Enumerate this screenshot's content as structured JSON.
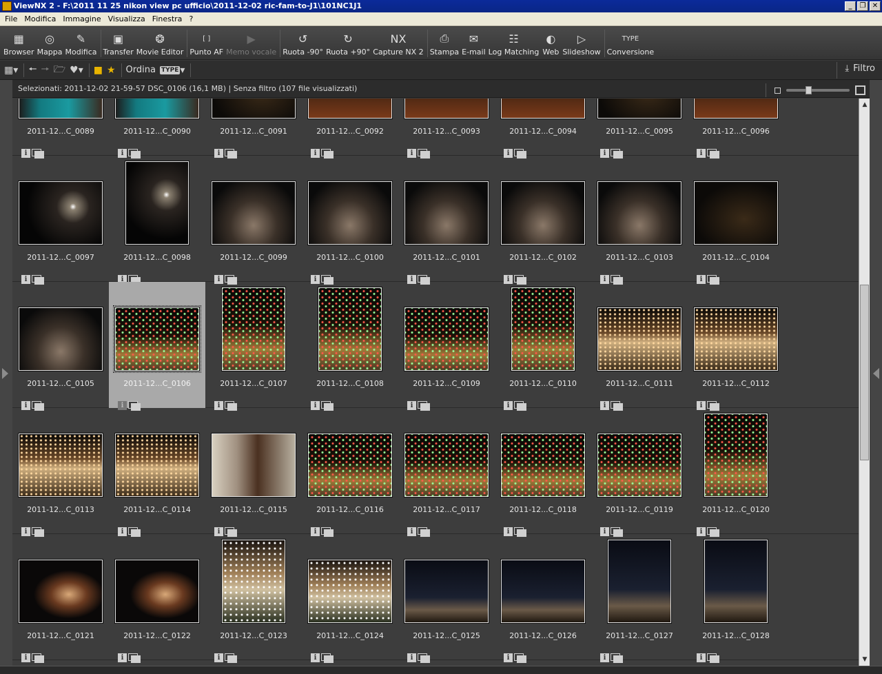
{
  "window": {
    "title": "ViewNX 2 - F:\\2011 11 25 nikon view pc ufficio\\2011-12-02 ric-fam-to-J1\\101NC1J1",
    "controls": [
      "_",
      "❐",
      "✕"
    ]
  },
  "menu": [
    "File",
    "Modifica",
    "Immagine",
    "Visualizza",
    "Finestra",
    "?"
  ],
  "toolbar": [
    {
      "label": "Browser",
      "icon": "browser-icon",
      "glyph": "▦",
      "enabled": true
    },
    {
      "label": "Mappa",
      "icon": "map-icon",
      "glyph": "◎",
      "enabled": true
    },
    {
      "label": "Modifica",
      "icon": "edit-icon",
      "glyph": "✎",
      "enabled": true
    },
    {
      "sep": true
    },
    {
      "label": "Transfer",
      "icon": "camera-transfer-icon",
      "glyph": "▣",
      "enabled": true
    },
    {
      "label": "Movie Editor",
      "icon": "film-reel-icon",
      "glyph": "❂",
      "enabled": true
    },
    {
      "sep": true
    },
    {
      "label": "Punto AF",
      "icon": "af-point-icon",
      "glyph": "[ ]",
      "enabled": true
    },
    {
      "label": "Memo vocale",
      "icon": "voice-memo-icon",
      "glyph": "▶",
      "enabled": false
    },
    {
      "sep": true
    },
    {
      "label": "Ruota -90°",
      "icon": "rotate-left-icon",
      "glyph": "↺",
      "enabled": true
    },
    {
      "label": "Ruota +90°",
      "icon": "rotate-right-icon",
      "glyph": "↻",
      "enabled": true
    },
    {
      "label": "Capture NX 2",
      "icon": "capture-nx-icon",
      "glyph": "NX",
      "enabled": true
    },
    {
      "sep": true
    },
    {
      "label": "Stampa",
      "icon": "printer-icon",
      "glyph": "⎙",
      "enabled": true
    },
    {
      "label": "E-mail",
      "icon": "envelope-icon",
      "glyph": "✉",
      "enabled": true
    },
    {
      "label": "Log Matching",
      "icon": "log-matching-icon",
      "glyph": "☷",
      "enabled": true
    },
    {
      "label": "Web",
      "icon": "globe-icon",
      "glyph": "◐",
      "enabled": true
    },
    {
      "label": "Slideshow",
      "icon": "slideshow-icon",
      "glyph": "▷",
      "enabled": true
    },
    {
      "sep": true
    },
    {
      "label": "Conversione",
      "icon": "convert-type-icon",
      "glyph": "TYPE",
      "enabled": true
    }
  ],
  "toolbar2": {
    "sort_label": "Ordina",
    "type_badge": "TYPE",
    "filter_label": "Filtro"
  },
  "status": {
    "text": "Selezionati: 2011-12-02 21-59-57 DSC_0106 (16,1 MB) | Senza filtro  (107 file visualizzati)"
  },
  "thumbnails": {
    "selected": "2011-12...C_0106",
    "rows": [
      [
        {
          "label": "2011-12...C_0089",
          "style": "p-teal",
          "orient": "landscape"
        },
        {
          "label": "2011-12...C_0090",
          "style": "p-teal",
          "orient": "landscape"
        },
        {
          "label": "2011-12...C_0091",
          "style": "p-night",
          "orient": "landscape"
        },
        {
          "label": "2011-12...C_0092",
          "style": "p-street",
          "orient": "landscape"
        },
        {
          "label": "2011-12...C_0093",
          "style": "p-street",
          "orient": "landscape"
        },
        {
          "label": "2011-12...C_0094",
          "style": "p-street",
          "orient": "landscape"
        },
        {
          "label": "2011-12...C_0095",
          "style": "p-night",
          "orient": "landscape"
        },
        {
          "label": "2011-12...C_0096",
          "style": "p-street",
          "orient": "landscape"
        }
      ],
      [
        {
          "label": "2011-12...C_0097",
          "style": "p-church",
          "orient": "landscape"
        },
        {
          "label": "2011-12...C_0098",
          "style": "p-church",
          "orient": "portrait"
        },
        {
          "label": "2011-12...C_0099",
          "style": "p-gate",
          "orient": "landscape"
        },
        {
          "label": "2011-12...C_0100",
          "style": "p-gate",
          "orient": "landscape"
        },
        {
          "label": "2011-12...C_0101",
          "style": "p-gate",
          "orient": "landscape"
        },
        {
          "label": "2011-12...C_0102",
          "style": "p-gate",
          "orient": "landscape"
        },
        {
          "label": "2011-12...C_0103",
          "style": "p-gate",
          "orient": "landscape"
        },
        {
          "label": "2011-12...C_0104",
          "style": "p-night",
          "orient": "landscape"
        }
      ],
      [
        {
          "label": "2011-12...C_0105",
          "style": "p-gate",
          "orient": "landscape"
        },
        {
          "label": "2011-12...C_0106",
          "style": "p-lights",
          "orient": "landscape"
        },
        {
          "label": "2011-12...C_0107",
          "style": "p-lights",
          "orient": "portrait"
        },
        {
          "label": "2011-12...C_0108",
          "style": "p-lights",
          "orient": "portrait"
        },
        {
          "label": "2011-12...C_0109",
          "style": "p-lights",
          "orient": "landscape"
        },
        {
          "label": "2011-12...C_0110",
          "style": "p-lights",
          "orient": "portrait"
        },
        {
          "label": "2011-12...C_0111",
          "style": "p-square",
          "orient": "landscape"
        },
        {
          "label": "2011-12...C_0112",
          "style": "p-square",
          "orient": "landscape"
        }
      ],
      [
        {
          "label": "2011-12...C_0113",
          "style": "p-square",
          "orient": "landscape"
        },
        {
          "label": "2011-12...C_0114",
          "style": "p-square",
          "orient": "landscape"
        },
        {
          "label": "2011-12...C_0115",
          "style": "p-statue",
          "orient": "landscape"
        },
        {
          "label": "2011-12...C_0116",
          "style": "p-lights",
          "orient": "landscape"
        },
        {
          "label": "2011-12...C_0117",
          "style": "p-lights",
          "orient": "landscape"
        },
        {
          "label": "2011-12...C_0118",
          "style": "p-lights",
          "orient": "landscape"
        },
        {
          "label": "2011-12...C_0119",
          "style": "p-lights",
          "orient": "landscape"
        },
        {
          "label": "2011-12...C_0120",
          "style": "p-lights",
          "orient": "portrait"
        }
      ],
      [
        {
          "label": "2011-12...C_0121",
          "style": "p-portrait",
          "orient": "landscape"
        },
        {
          "label": "2011-12...C_0122",
          "style": "p-portrait",
          "orient": "landscape"
        },
        {
          "label": "2011-12...C_0123",
          "style": "p-crib",
          "orient": "portrait"
        },
        {
          "label": "2011-12...C_0124",
          "style": "p-crib",
          "orient": "landscape"
        },
        {
          "label": "2011-12...C_0125",
          "style": "p-tower",
          "orient": "landscape"
        },
        {
          "label": "2011-12...C_0126",
          "style": "p-tower",
          "orient": "landscape"
        },
        {
          "label": "2011-12...C_0127",
          "style": "p-tower",
          "orient": "portrait"
        },
        {
          "label": "2011-12...C_0128",
          "style": "p-tower",
          "orient": "portrait"
        }
      ]
    ]
  }
}
